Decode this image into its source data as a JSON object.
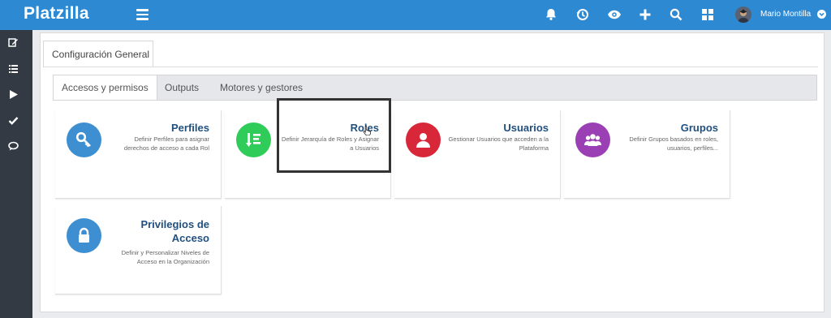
{
  "header": {
    "brand": "Platzilla",
    "user_name": "Mario Montilla",
    "icons": [
      "bell-icon",
      "history-icon",
      "eye-icon",
      "plus-icon",
      "search-icon",
      "grid-icon"
    ]
  },
  "sidebar": {
    "icons": [
      "edit-icon",
      "list-icon",
      "play-icon",
      "check-icon",
      "chat-icon"
    ]
  },
  "main": {
    "tab": "Configuración General",
    "subtabs": [
      "Accesos y permisos",
      "Outputs",
      "Motores y gestores"
    ],
    "cards": [
      {
        "title": "Perfiles",
        "desc": "Definir Perfiles para asignar derechos de acceso a cada Rol",
        "icon": "key-icon",
        "color": "#3d8fd1"
      },
      {
        "title": "Roles",
        "desc": "Definir Jerarquía de Roles y Asignar a Usuarios",
        "icon": "hierarchy-icon",
        "color": "#2fcc5a"
      },
      {
        "title": "Usuarios",
        "desc": "Gestionar Usuarios que acceden a la Plataforma",
        "icon": "user-icon",
        "color": "#d9273a"
      },
      {
        "title": "Grupos",
        "desc": "Definir Grupos basados en roles, usuarios, perfiles...",
        "icon": "users-icon",
        "color": "#9b3fb4"
      },
      {
        "title": "Privilegios de Acceso",
        "desc": "Definir y Personalizar Niveles de Acceso en la Organización",
        "icon": "lock-icon",
        "color": "#3d8fd1"
      }
    ]
  },
  "colors": {
    "header": "#2e89d3",
    "sidebar": "#333a44",
    "title": "#21507f"
  }
}
